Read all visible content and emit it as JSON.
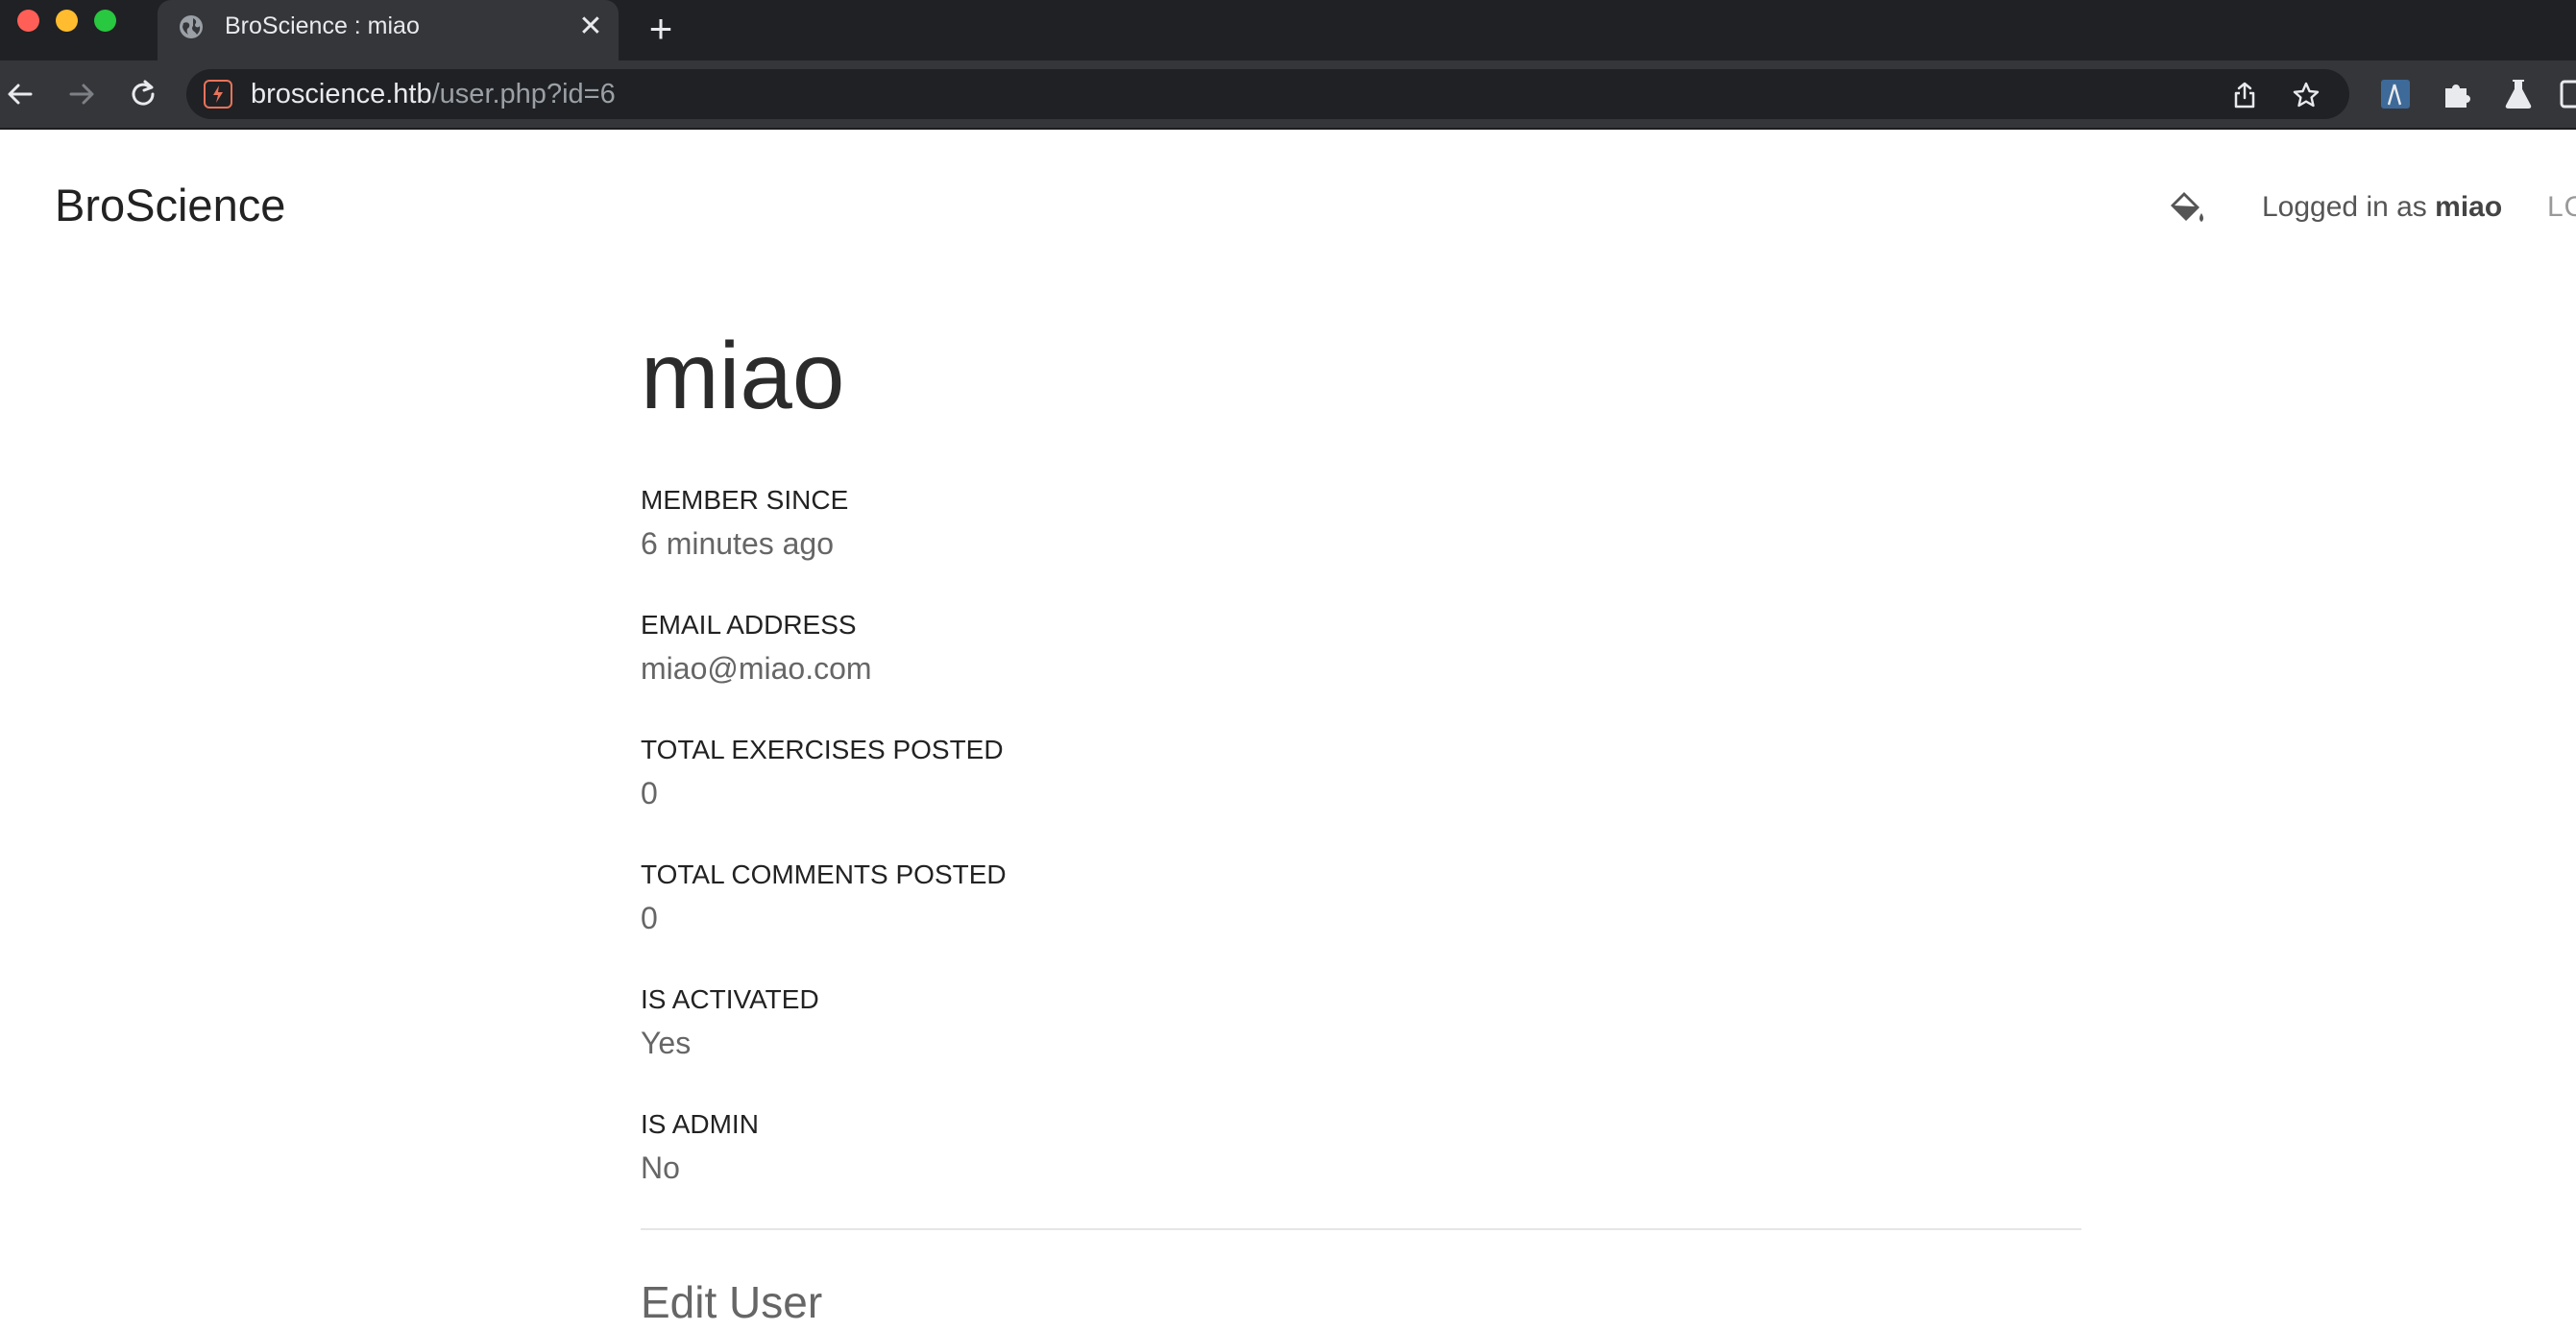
{
  "browser": {
    "tab_title": "BroScience : miao",
    "url_host": "broscience.htb",
    "url_path": "/user.php?id=6"
  },
  "nav": {
    "brand": "BroScience",
    "logged_in_prefix": "Logged in as ",
    "logged_in_user": "miao",
    "logout_label": "LO"
  },
  "profile": {
    "username": "miao",
    "fields": [
      {
        "label": "MEMBER SINCE",
        "value": "6 minutes ago"
      },
      {
        "label": "EMAIL ADDRESS",
        "value": "miao@miao.com"
      },
      {
        "label": "TOTAL EXERCISES POSTED",
        "value": "0"
      },
      {
        "label": "TOTAL COMMENTS POSTED",
        "value": "0"
      },
      {
        "label": "IS ACTIVATED",
        "value": "Yes"
      },
      {
        "label": "IS ADMIN",
        "value": "No"
      }
    ],
    "edit_heading": "Edit User"
  }
}
